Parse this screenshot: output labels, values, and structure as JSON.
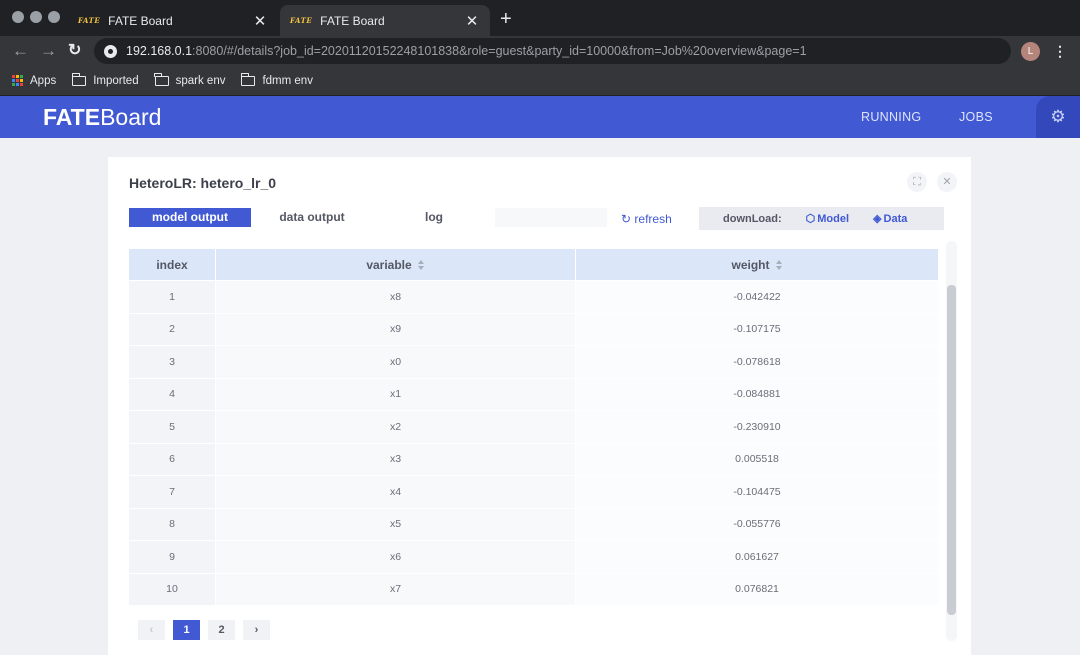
{
  "browser": {
    "tabs": [
      {
        "favicon": "FATE",
        "title": "FATE Board"
      },
      {
        "favicon": "FATE",
        "title": "FATE Board"
      }
    ],
    "new_tab": "+",
    "url_host": "192.168.0.1",
    "url_rest": ":8080/#/details?job_id=20201120152248101838&role=guest&party_id=10000&from=Job%20overview&page=1",
    "profile_initial": "L",
    "bookmarks": [
      "Apps",
      "Imported",
      "spark env",
      "fdmm env"
    ]
  },
  "app": {
    "logo_bold": "FATE",
    "logo_rest": "Board",
    "nav": [
      "RUNNING",
      "JOBS"
    ],
    "accent": "#4159d2"
  },
  "panel": {
    "title": "HeteroLR: hetero_lr_0",
    "tabs": [
      "model output",
      "data output",
      "log"
    ],
    "refresh_label": "refresh",
    "download_label": "downLoad:",
    "download_model": "Model",
    "download_data": "Data"
  },
  "table": {
    "headers": [
      "index",
      "variable",
      "weight"
    ],
    "rows": [
      {
        "index": "1",
        "variable": "x8",
        "weight": "-0.042422"
      },
      {
        "index": "2",
        "variable": "x9",
        "weight": "-0.107175"
      },
      {
        "index": "3",
        "variable": "x0",
        "weight": "-0.078618"
      },
      {
        "index": "4",
        "variable": "x1",
        "weight": "-0.084881"
      },
      {
        "index": "5",
        "variable": "x2",
        "weight": "-0.230910"
      },
      {
        "index": "6",
        "variable": "x3",
        "weight": "0.005518"
      },
      {
        "index": "7",
        "variable": "x4",
        "weight": "-0.104475"
      },
      {
        "index": "8",
        "variable": "x5",
        "weight": "-0.055776"
      },
      {
        "index": "9",
        "variable": "x6",
        "weight": "0.061627"
      },
      {
        "index": "10",
        "variable": "x7",
        "weight": "0.076821"
      }
    ]
  },
  "pagination": {
    "prev": "‹",
    "pages": [
      "1",
      "2"
    ],
    "current": "1",
    "next": "›"
  }
}
